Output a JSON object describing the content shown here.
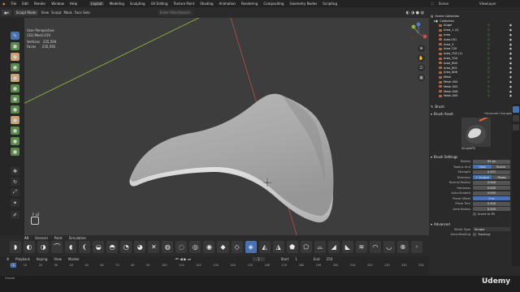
{
  "app": {
    "menus": [
      "File",
      "Edit",
      "Render",
      "Window",
      "Help"
    ],
    "workspaces": [
      "Layout",
      "Modeling",
      "Sculpting",
      "UV Editing",
      "Texture Paint",
      "Shading",
      "Animation",
      "Rendering",
      "Compositing",
      "Geometry Nodes",
      "Scripting"
    ],
    "active_workspace": "Layout",
    "scene_label": "Scene",
    "view_layer_label": "ViewLayer"
  },
  "header": {
    "mode": "Sculpt Mode",
    "menus": [
      "View",
      "Sculpt",
      "Mask",
      "Face Sets"
    ],
    "search": "Enter Filter/Search"
  },
  "tool_settings": {
    "brush_name": "SimpleFill",
    "radius_label": "Radius",
    "radius_value": "85 px",
    "strength_label": "Strength",
    "strength_value": "0.297",
    "menus": [
      "Brush",
      "Texture",
      "Stroke",
      "Falloff",
      "Cursor"
    ],
    "right_labels": [
      "Dyntopo",
      "Remesh",
      "Options"
    ]
  },
  "viewport": {
    "view_name": "User Perspective",
    "object_name": "(32) Mesh.019",
    "vertices_label": "Vertices",
    "vertices_value": "235,594",
    "faces_label": "Faces",
    "faces_value": "235,592",
    "hint": "F x2",
    "background": "#3d3d3d",
    "mesh_color": "#bdbdbd"
  },
  "shelf": {
    "tabs": [
      "All",
      "General",
      "Paint",
      "Simulation"
    ],
    "brush_count": 30,
    "selected_index": 17
  },
  "timeline": {
    "menus": [
      "Playback",
      "Keying",
      "View",
      "Marker"
    ],
    "frame_ticks": [
      "0",
      "10",
      "20",
      "30",
      "40",
      "50",
      "60",
      "70",
      "80",
      "90",
      "100",
      "110",
      "120",
      "130",
      "140",
      "150",
      "160",
      "170",
      "180",
      "190",
      "200",
      "210",
      "220",
      "230",
      "240",
      "250"
    ],
    "current_frame": "1",
    "start_label": "Start",
    "start_value": "1",
    "end_label": "End",
    "end_value": "250"
  },
  "status": {
    "text": "Cancel"
  },
  "outliner": {
    "title": "Scene Collection",
    "root": "Collection",
    "items": [
      "Angel",
      "Area_1 (1)",
      "Area",
      "Area.001",
      "Area_2",
      "Area.720",
      "Area_702 (1)",
      "Area_704",
      "Area_800",
      "Area_801",
      "Area_806",
      "Mesh",
      "Mesh.000",
      "Mesh.003",
      "Mesh.008",
      "Mesh.009"
    ]
  },
  "properties": {
    "tab_label": "Brush",
    "brush_asset_label": "Brush Asset",
    "unsaved_label": "*Unsaved Changes",
    "asset_name": "SimpleFill",
    "brush_settings_label": "Brush Settings",
    "rows": [
      {
        "label": "Radius",
        "value": "85 px",
        "style": "normal"
      },
      {
        "label": "Radius Unit",
        "value": "View",
        "value2": "Scene",
        "style": "toggle"
      },
      {
        "label": "Strength",
        "value": "0.297",
        "style": "normal"
      },
      {
        "label": "Direction",
        "value": "+ Scrape",
        "value2": "- Peaks",
        "style": "toggle"
      },
      {
        "label": "Normal Radius",
        "value": "0.500",
        "style": "normal"
      },
      {
        "label": "Hardness",
        "value": "0.000",
        "style": "normal"
      },
      {
        "label": "Auto-Smooth",
        "value": "0.000",
        "style": "normal"
      },
      {
        "label": "Plane Offset",
        "value": "0 m",
        "style": "blue"
      },
      {
        "label": "Plane Trim",
        "value": "0.500",
        "style": "normal"
      },
      {
        "label": "Area Radius",
        "value": "0.500",
        "style": "normal"
      }
    ],
    "invert_fill_label": "Invert to Fill",
    "advanced_label": "Advanced",
    "brush_type_label": "Brush Type",
    "brush_type_value": "Scrape",
    "auto_masking_label": "Auto-Masking",
    "topology_label": "Topology"
  },
  "watermark": "Udemy",
  "colors": {
    "accent_blue": "#4772b3",
    "orange_icon": "#b4683f",
    "x_axis": "#b14b4b",
    "y_axis": "#8ab43f"
  }
}
